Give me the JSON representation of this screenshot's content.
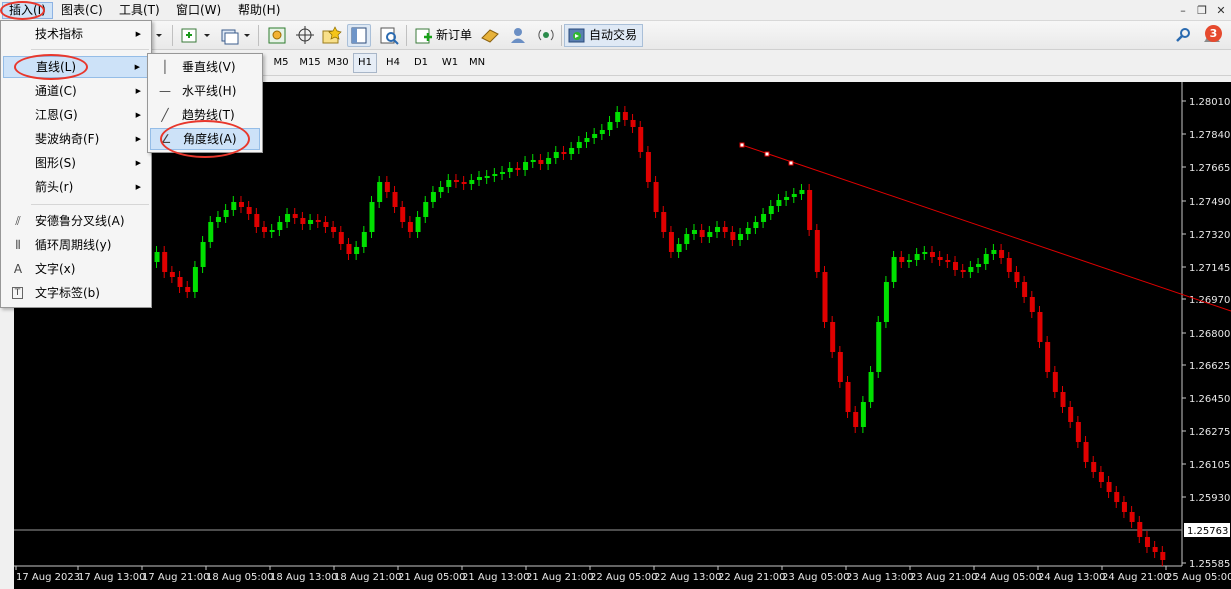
{
  "menubar": {
    "items": [
      "插入(I)",
      "图表(C)",
      "工具(T)",
      "窗口(W)",
      "帮助(H)"
    ]
  },
  "toolbar": {
    "new_order_label": "新订单",
    "auto_trade_label": "自动交易",
    "notification_count": "3"
  },
  "timeframes": [
    "M5",
    "M15",
    "M30",
    "H1",
    "H4",
    "D1",
    "W1",
    "MN"
  ],
  "timeframe_selected": "H1",
  "insert_menu": {
    "items": [
      {
        "label": "技术指标",
        "submenu": true
      },
      {
        "label": "直线(L)",
        "submenu": true
      },
      {
        "label": "通道(C)",
        "submenu": true
      },
      {
        "label": "江恩(G)",
        "submenu": true
      },
      {
        "label": "斐波纳奇(F)",
        "submenu": true
      },
      {
        "label": "图形(S)",
        "submenu": true
      },
      {
        "label": "箭头(r)",
        "submenu": true
      },
      {
        "label": "安德鲁分叉线(A)",
        "icon": "andrews-pitchfork-icon"
      },
      {
        "label": "循环周期线(y)",
        "icon": "cycle-lines-icon"
      },
      {
        "label": "文字(x)",
        "icon": "text-icon"
      },
      {
        "label": "文字标签(b)",
        "icon": "text-label-icon"
      }
    ]
  },
  "lines_submenu": {
    "items": [
      {
        "label": "垂直线(V)",
        "icon": "vertical-line-icon"
      },
      {
        "label": "水平线(H)",
        "icon": "horizontal-line-icon"
      },
      {
        "label": "趋势线(T)",
        "icon": "trendline-icon"
      },
      {
        "label": "角度线(A)",
        "icon": "angle-line-icon"
      }
    ]
  },
  "price_axis": [
    "1.28010",
    "1.27840",
    "1.27665",
    "1.27490",
    "1.27320",
    "1.27145",
    "1.26970",
    "1.26800",
    "1.26625",
    "1.26450",
    "1.26275",
    "1.26105",
    "1.25930",
    "1.25585"
  ],
  "current_price": "1.25763",
  "time_axis": [
    "17 Aug 2023",
    "17 Aug 13:00",
    "17 Aug 21:00",
    "18 Aug 05:00",
    "18 Aug 13:00",
    "18 Aug 21:00",
    "21 Aug 05:00",
    "21 Aug 13:00",
    "21 Aug 21:00",
    "22 Aug 05:00",
    "22 Aug 13:00",
    "22 Aug 21:00",
    "23 Aug 05:00",
    "23 Aug 13:00",
    "23 Aug 21:00",
    "24 Aug 05:00",
    "24 Aug 13:00",
    "24 Aug 21:00",
    "25 Aug 05:00"
  ],
  "colors": {
    "bull": "#00e000",
    "bear": "#e00000",
    "trendline": "#e00000",
    "background": "#000000",
    "highlight_ellipse": "#e8372c"
  }
}
